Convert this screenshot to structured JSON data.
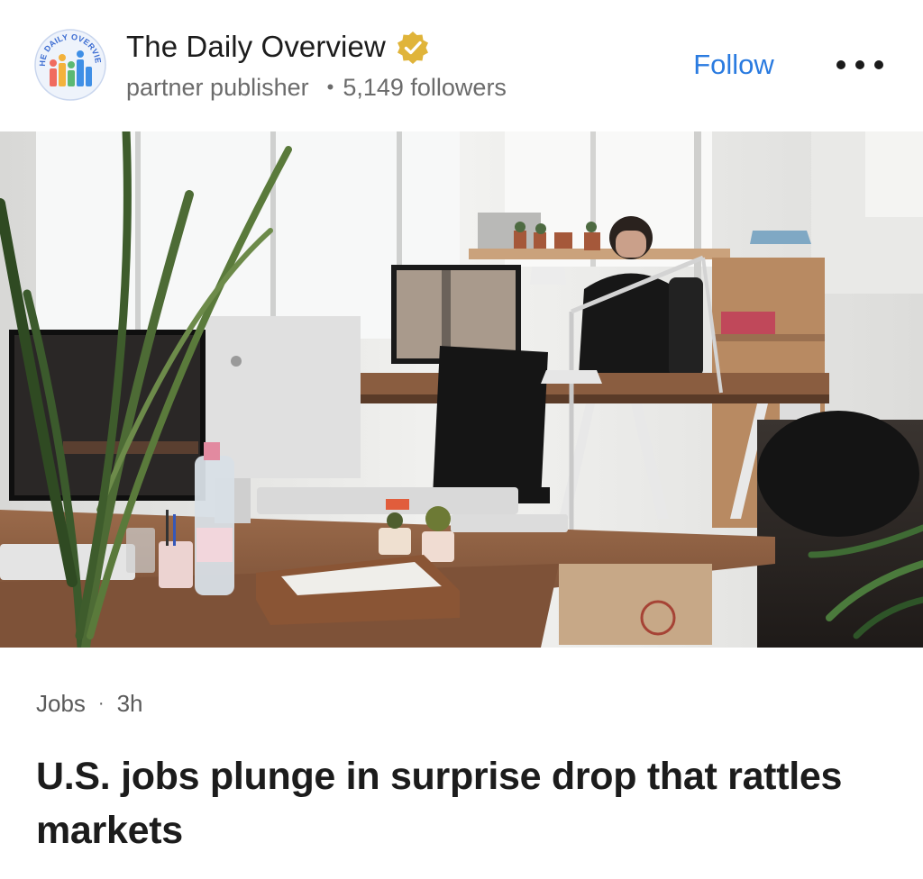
{
  "publisher": {
    "name": "The Daily Overview",
    "logo_text": "THE DAILY OVERVIEW",
    "verified_icon": "verified-badge-icon",
    "type": "partner publisher",
    "followers": "5,149 followers"
  },
  "actions": {
    "follow_label": "Follow",
    "more_icon": "more-horizontal-icon"
  },
  "hero": {
    "image": "office-desks-photo"
  },
  "article": {
    "category": "Jobs",
    "age": "3h",
    "headline": "U.S. jobs plunge in surprise drop that rattles markets"
  },
  "colors": {
    "accent": "#2a7be0",
    "verified": "#e0b43a",
    "muted_text": "#6b6b6b"
  }
}
